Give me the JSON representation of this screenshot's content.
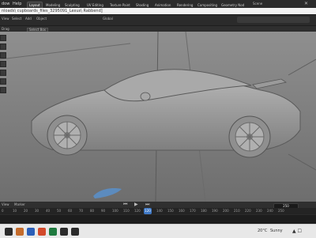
{
  "menubar": {
    "items": [
      "dow",
      "Help"
    ],
    "tabs": [
      "Layout",
      "Modeling",
      "Sculpting",
      "UV Editing",
      "Texture Paint",
      "Shading",
      "Animation",
      "Rendering",
      "Compositing",
      "Geometry Nod"
    ],
    "scene_label": "Scene"
  },
  "title": {
    "text": "nloads\\ cupboards_files_3295091_Lexus\\ Rabbend]"
  },
  "workspace": {
    "view_items": [
      "View",
      "Select",
      "Add",
      "Object"
    ],
    "transform_label": "Global",
    "left_dropdown": "Drag",
    "dropdown_value": "Select Box"
  },
  "timeline": {
    "left_items": [
      "View",
      "Marker"
    ],
    "ticks": [
      "0",
      "10",
      "20",
      "30",
      "40",
      "50",
      "60",
      "70",
      "80",
      "90",
      "100",
      "110",
      "120",
      "130",
      "140",
      "150",
      "160",
      "170",
      "180",
      "190",
      "200",
      "210",
      "220",
      "230",
      "240",
      "250"
    ],
    "current_frame_box": "250",
    "playhead_frame": "120"
  },
  "taskbar": {
    "weather": "20°C",
    "weather_desc": "Sunny"
  }
}
